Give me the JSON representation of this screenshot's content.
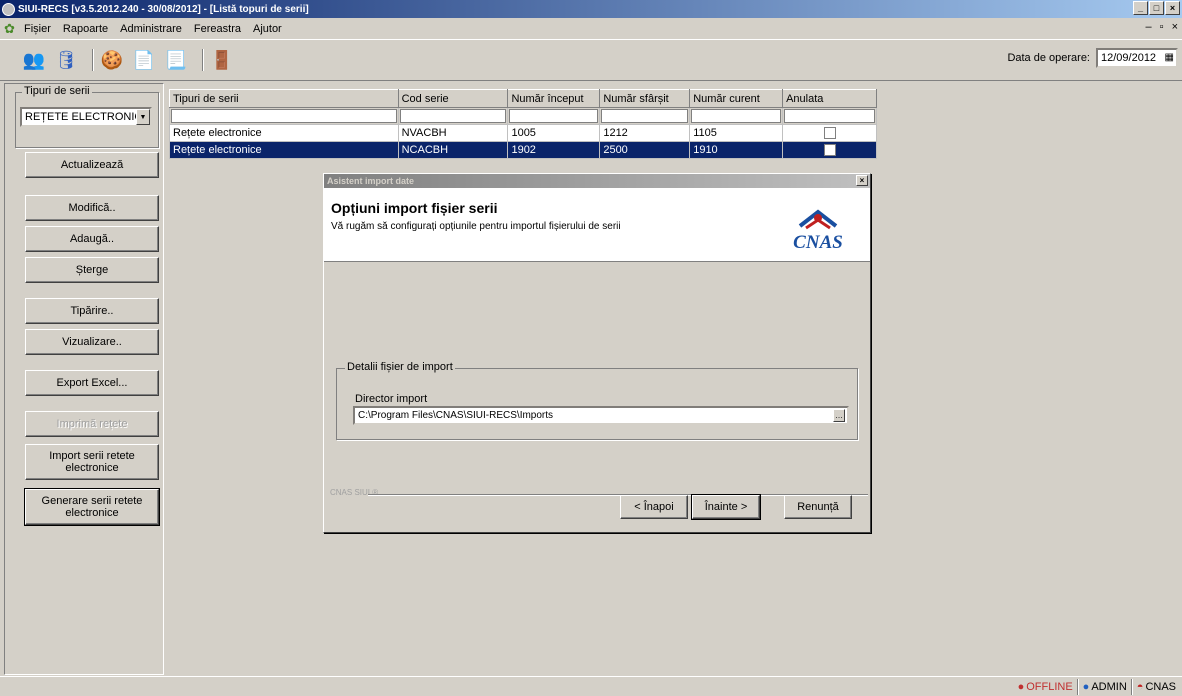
{
  "window": {
    "title": "SIUI-RECS [v3.5.2012.240 - 30/08/2012] - [Listă topuri de serii]"
  },
  "menu": {
    "items": [
      "Fișier",
      "Rapoarte",
      "Administrare",
      "Fereastra",
      "Ajutor"
    ]
  },
  "toolbar": {
    "op_date_label": "Data de operare:",
    "op_date_value": "12/09/2012"
  },
  "left": {
    "group_label": "Tipuri de serii",
    "combo_value": "REȚETE ELECTRONICE",
    "buttons": {
      "update": "Actualizează",
      "modify": "Modifică..",
      "add": "Adaugă..",
      "delete": "Șterge",
      "print": "Tipărire..",
      "view": "Vizualizare..",
      "export": "Export Excel...",
      "print_recipes": "Imprimă rețete",
      "import": "Import serii retete electronice",
      "generate": "Generare serii retete electronice"
    }
  },
  "grid": {
    "headers": [
      "Tipuri de serii",
      "Cod serie",
      "Număr început",
      "Număr sfârșit",
      "Număr curent",
      "Anulata"
    ],
    "rows": [
      {
        "type": "Rețete electronice",
        "code": "NVACBH",
        "start": "1005",
        "end": "1212",
        "current": "1105",
        "cancelled": false
      },
      {
        "type": "Rețete electronice",
        "code": "NCACBH",
        "start": "1902",
        "end": "2500",
        "current": "1910",
        "cancelled": false
      }
    ]
  },
  "dialog": {
    "title": "Asistent import date",
    "header_title": "Opțiuni import fișier serii",
    "header_sub": "Vă rugăm să configurați opțiunile pentru importul fișierului de serii",
    "logo_text": "CNAS",
    "group_label": "Detalii fișier de import",
    "dir_label": "Director import",
    "dir_value": "C:\\Program Files\\CNAS\\SIUI-RECS\\Imports",
    "footer_label": "CNAS SIUI ®",
    "back": "< Înapoi",
    "next": "Înainte >",
    "cancel": "Renunță"
  },
  "status": {
    "offline": "OFFLINE",
    "user": "ADMIN",
    "org": "CNAS"
  }
}
